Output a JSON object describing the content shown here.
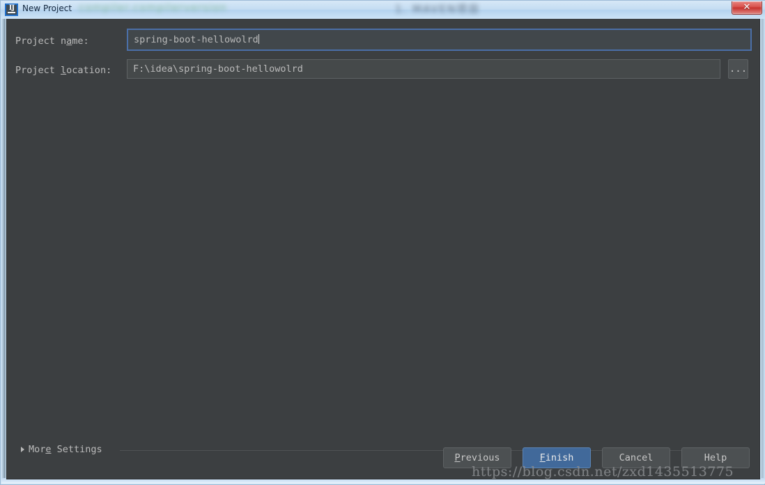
{
  "window": {
    "title": "New Project",
    "icon": "intellij-idea-icon",
    "close_label": "✕",
    "background_text_left": "compiler.compilerversion",
    "background_text_right": "1. MAVEN项目"
  },
  "form": {
    "project_name": {
      "label_before": "Project n",
      "label_mnemonic": "a",
      "label_after": "me:",
      "value": "spring-boot-hellowolrd",
      "focused": true
    },
    "project_location": {
      "label_before": "Project ",
      "label_mnemonic": "l",
      "label_after": "ocation:",
      "value": "F:\\idea\\spring-boot-hellowolrd",
      "focused": false
    },
    "browse_button_label": "..."
  },
  "more_settings": {
    "label_before": "Mor",
    "label_mnemonic": "e",
    "label_after": " Settings",
    "expanded": false,
    "arrow": "chevron-right-icon"
  },
  "buttons": [
    {
      "name": "previous",
      "before": "",
      "mnemonic": "P",
      "after": "revious",
      "primary": false
    },
    {
      "name": "finish",
      "before": "",
      "mnemonic": "F",
      "after": "inish",
      "primary": true
    },
    {
      "name": "cancel",
      "before": "Cancel",
      "mnemonic": "",
      "after": "",
      "primary": false
    },
    {
      "name": "help",
      "before": "Help",
      "mnemonic": "",
      "after": "",
      "primary": false
    }
  ],
  "watermark": {
    "text": "https://blog.csdn.net/zxd1435513775"
  },
  "colors": {
    "panel_background": "#3c3f41",
    "field_background": "#45494a",
    "focus_border": "#4b6fa8",
    "primary_button": "#41699a",
    "text": "#bbbbbb",
    "titlebar_gradient_top": "#d7e8f7",
    "close_button_red": "#c6302b"
  }
}
